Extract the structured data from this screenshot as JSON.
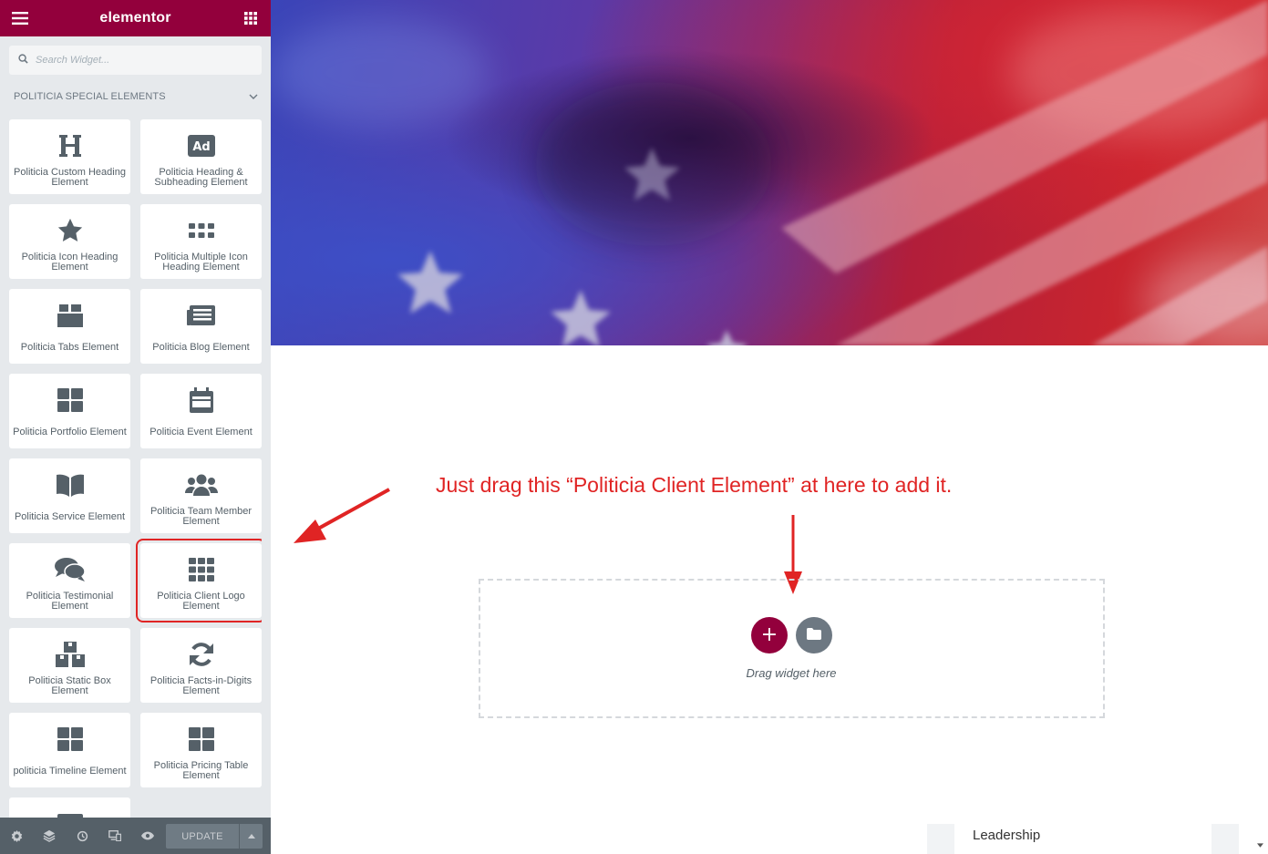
{
  "panel": {
    "brand": "elementor",
    "menu_icon": "hamburger-icon",
    "apps_icon": "grid-icon",
    "search": {
      "placeholder": "Search Widget...",
      "value": ""
    },
    "category": "POLITICIA SPECIAL ELEMENTS",
    "widgets": [
      {
        "label": "Politicia Custom Heading Element",
        "icon": "heading-icon"
      },
      {
        "label": "Politicia Heading & Subheading Element",
        "icon": "ad-icon"
      },
      {
        "label": "Politicia Icon Heading Element",
        "icon": "star-icon"
      },
      {
        "label": "Politicia Multiple Icon Heading Element",
        "icon": "dots-grid-icon"
      },
      {
        "label": "Politicia Tabs Element",
        "icon": "box-icon"
      },
      {
        "label": "Politicia Blog Element",
        "icon": "newspaper-icon"
      },
      {
        "label": "Politicia Portfolio Element",
        "icon": "tiles-icon"
      },
      {
        "label": "Politicia Event Element",
        "icon": "calendar-icon"
      },
      {
        "label": "Politicia Service Element",
        "icon": "book-icon"
      },
      {
        "label": "Politicia Team Member Element",
        "icon": "users-icon"
      },
      {
        "label": "Politicia Testimonial Element",
        "icon": "comments-icon"
      },
      {
        "label": "Politicia Client Logo Element",
        "icon": "grid-icon"
      },
      {
        "label": "Politicia Static Box Element",
        "icon": "boxes-icon"
      },
      {
        "label": "Politicia Facts-in-Digits Element",
        "icon": "refresh-icon"
      },
      {
        "label": "politicia Timeline Element",
        "icon": "tiles-icon"
      },
      {
        "label": "Politicia Pricing Table Element",
        "icon": "tiles-icon"
      }
    ],
    "footer": {
      "icons": [
        "settings-icon",
        "layers-icon",
        "history-icon",
        "responsive-icon",
        "preview-icon"
      ],
      "update_label": "UPDATE"
    }
  },
  "canvas": {
    "instruction": "Just drag this “Politicia Client Element” at here to add it.",
    "drop_hint": "Drag widget here",
    "add_label": "+",
    "bottom_label": "Leadership"
  },
  "colors": {
    "brand": "#93003c",
    "annotation": "#e02424",
    "panel_bg": "#e6e9ec",
    "footer_bg": "#556068"
  }
}
